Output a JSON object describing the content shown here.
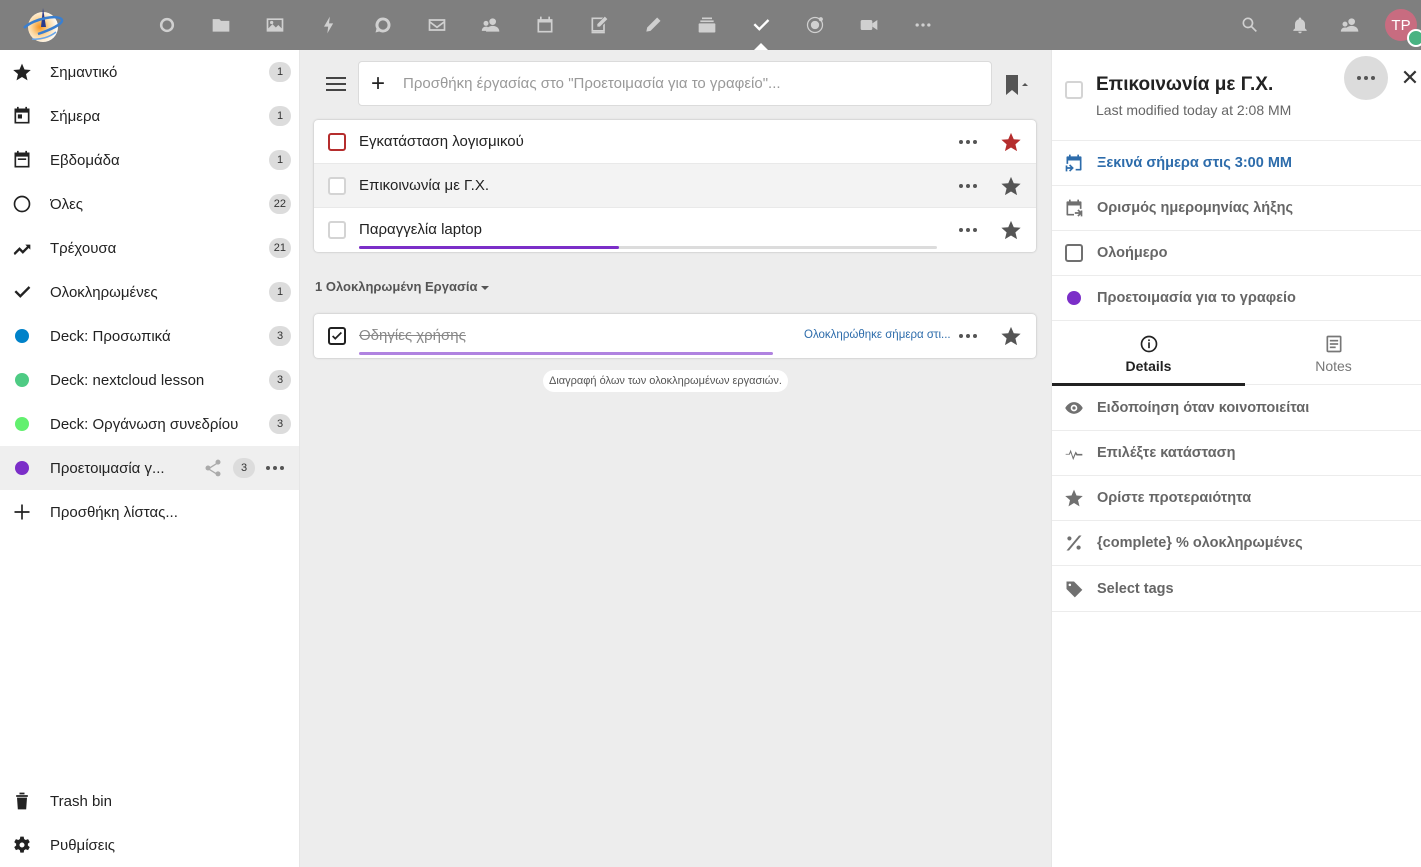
{
  "header": {
    "logo": "nextcloud-custom-logo",
    "apps": [
      {
        "name": "dashboard",
        "icon": "circle-icon"
      },
      {
        "name": "files",
        "icon": "folder-icon"
      },
      {
        "name": "photos",
        "icon": "image-icon"
      },
      {
        "name": "activity",
        "icon": "lightning-icon"
      },
      {
        "name": "talk",
        "icon": "chat-icon"
      },
      {
        "name": "mail",
        "icon": "mail-icon"
      },
      {
        "name": "contacts",
        "icon": "contacts-icon"
      },
      {
        "name": "calendar",
        "icon": "calendar-icon"
      },
      {
        "name": "notes",
        "icon": "notes-icon"
      },
      {
        "name": "text",
        "icon": "pencil-icon"
      },
      {
        "name": "deck",
        "icon": "deck-icon"
      },
      {
        "name": "tasks",
        "icon": "check-icon",
        "active": true
      },
      {
        "name": "circles",
        "icon": "orbit-icon"
      },
      {
        "name": "video",
        "icon": "video-icon"
      },
      {
        "name": "more",
        "icon": "more-icon"
      }
    ],
    "avatar_initials": "TP",
    "status_color": "#49b382"
  },
  "sidebar": {
    "items": [
      {
        "label": "Σημαντικό",
        "count": "1",
        "icon": "star-icon"
      },
      {
        "label": "Σήμερα",
        "count": "1",
        "icon": "calendar-today-icon"
      },
      {
        "label": "Εβδομάδα",
        "count": "1",
        "icon": "calendar-week-icon"
      },
      {
        "label": "Όλες",
        "count": "22",
        "icon": "circle-outline-icon"
      },
      {
        "label": "Τρέχουσα",
        "count": "21",
        "icon": "trending-icon"
      },
      {
        "label": "Ολοκληρωμένες",
        "count": "1",
        "icon": "check-icon"
      },
      {
        "label": "Deck: Προσωπικά",
        "count": "3",
        "color": "#0082c9"
      },
      {
        "label": "Deck: nextcloud lesson",
        "count": "3",
        "color": "#4ecb84"
      },
      {
        "label": "Deck: Οργάνωση συνεδρίου",
        "count": "3",
        "color": "#62f06f"
      },
      {
        "label": "Προετοιμασία γ...",
        "count": "3",
        "color": "#7b2ec8",
        "active": true
      }
    ],
    "add_list_label": "Προσθήκη λίστας...",
    "trash_label": "Trash bin",
    "settings_label": "Ρυθμίσεις"
  },
  "main": {
    "add_placeholder": "Προσθήκη έργασίας στο \"Προετοιμασία για το γραφείο\"...",
    "tasks": [
      {
        "title": "Εγκατάσταση λογισμικού",
        "priority": "high",
        "starred": true,
        "star_color": "#b52d2d"
      },
      {
        "title": "Επικοινωνία με Γ.Χ.",
        "selected": true,
        "star_color": "#555555"
      },
      {
        "title": "Παραγγελία laptop",
        "progress_percent": 45,
        "star_color": "#555555"
      }
    ],
    "completed_header": "1 Ολοκληρωμένη Εργασία",
    "completed_tasks": [
      {
        "title": "Οδηγίες χρήσης",
        "progress_percent": 100,
        "done_info": "Ολοκληρώθηκε σήμερα στι..."
      }
    ],
    "delete_completed_label": "Διαγραφή όλων των ολοκληρωμένων εργασιών.",
    "accent_color": "#7b2ec8"
  },
  "details": {
    "title": "Επικοινωνία με Γ.Χ.",
    "last_modified": "Last modified today at 2:08 ΜΜ",
    "start": "Ξεκινά σήμερα στις 3:00 ΜΜ",
    "due": "Ορισμός ημερομηνίας λήξης",
    "all_day": "Ολοήμερο",
    "calendar": "Προετοιμασία για το γραφείο",
    "calendar_color": "#7b2ec8",
    "tabs": [
      {
        "label": "Details",
        "icon": "info-icon",
        "active": true
      },
      {
        "label": "Notes",
        "icon": "notes-icon"
      }
    ],
    "rows": [
      {
        "label": "Ειδοποίηση όταν κοινοποιείται",
        "icon": "eye-icon"
      },
      {
        "label": "Επιλέξτε κατάσταση",
        "icon": "pulse-icon"
      },
      {
        "label": "Ορίστε προτεραιότητα",
        "icon": "star-icon"
      },
      {
        "label": "{complete} % ολοκληρωμένες",
        "icon": "percent-icon"
      },
      {
        "label": "Select tags",
        "icon": "tag-icon"
      }
    ],
    "link_color": "#2d6cab"
  }
}
